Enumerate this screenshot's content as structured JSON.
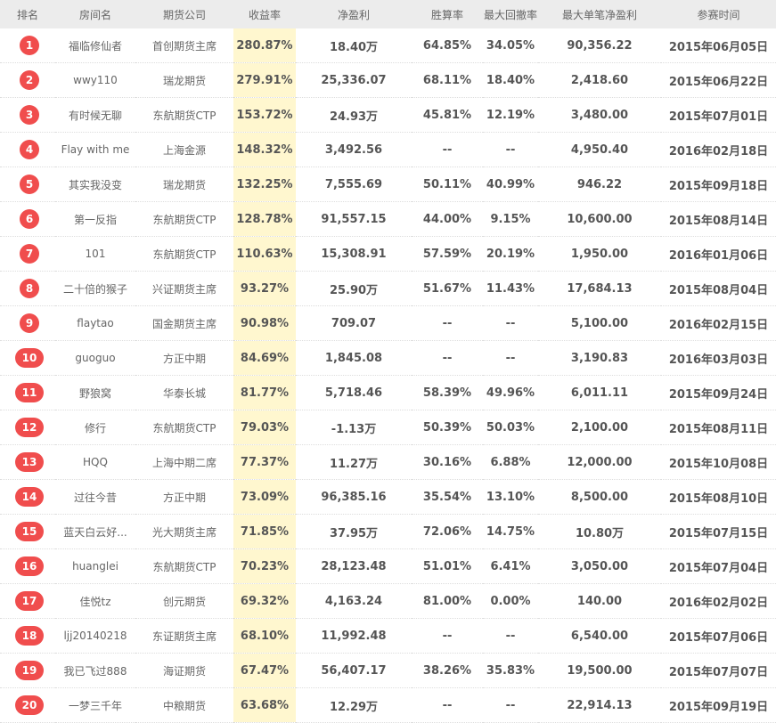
{
  "header": {
    "rank": "排名",
    "room": "房间名",
    "company": "期货公司",
    "return_rate": "收益率",
    "net_profit": "净盈利",
    "win_rate": "胜算率",
    "max_drawdown": "最大回撤率",
    "max_single": "最大单笔净盈利",
    "join_time": "参赛时间"
  },
  "rows": [
    {
      "rank": "1",
      "room": "福临修仙者",
      "company": "首创期货主席",
      "return_rate": "280.87%",
      "net_profit": "18.40万",
      "win_rate": "64.85%",
      "max_drawdown": "34.05%",
      "max_single": "90,356.22",
      "join_time": "2015年06月05日"
    },
    {
      "rank": "2",
      "room": "wwy110",
      "company": "瑞龙期货",
      "return_rate": "279.91%",
      "net_profit": "25,336.07",
      "win_rate": "68.11%",
      "max_drawdown": "18.40%",
      "max_single": "2,418.60",
      "join_time": "2015年06月22日"
    },
    {
      "rank": "3",
      "room": "有时候无聊",
      "company": "东航期货CTP",
      "return_rate": "153.72%",
      "net_profit": "24.93万",
      "win_rate": "45.81%",
      "max_drawdown": "12.19%",
      "max_single": "3,480.00",
      "join_time": "2015年07月01日"
    },
    {
      "rank": "4",
      "room": "Flay with me",
      "company": "上海金源",
      "return_rate": "148.32%",
      "net_profit": "3,492.56",
      "win_rate": "--",
      "max_drawdown": "--",
      "max_single": "4,950.40",
      "join_time": "2016年02月18日"
    },
    {
      "rank": "5",
      "room": "其实我没变",
      "company": "瑞龙期货",
      "return_rate": "132.25%",
      "net_profit": "7,555.69",
      "win_rate": "50.11%",
      "max_drawdown": "40.99%",
      "max_single": "946.22",
      "join_time": "2015年09月18日"
    },
    {
      "rank": "6",
      "room": "第一反指",
      "company": "东航期货CTP",
      "return_rate": "128.78%",
      "net_profit": "91,557.15",
      "win_rate": "44.00%",
      "max_drawdown": "9.15%",
      "max_single": "10,600.00",
      "join_time": "2015年08月14日"
    },
    {
      "rank": "7",
      "room": "101",
      "company": "东航期货CTP",
      "return_rate": "110.63%",
      "net_profit": "15,308.91",
      "win_rate": "57.59%",
      "max_drawdown": "20.19%",
      "max_single": "1,950.00",
      "join_time": "2016年01月06日"
    },
    {
      "rank": "8",
      "room": "二十倍的猴子",
      "company": "兴证期货主席",
      "return_rate": "93.27%",
      "net_profit": "25.90万",
      "win_rate": "51.67%",
      "max_drawdown": "11.43%",
      "max_single": "17,684.13",
      "join_time": "2015年08月04日"
    },
    {
      "rank": "9",
      "room": "flaytao",
      "company": "国金期货主席",
      "return_rate": "90.98%",
      "net_profit": "709.07",
      "win_rate": "--",
      "max_drawdown": "--",
      "max_single": "5,100.00",
      "join_time": "2016年02月15日"
    },
    {
      "rank": "10",
      "room": "guoguo",
      "company": "方正中期",
      "return_rate": "84.69%",
      "net_profit": "1,845.08",
      "win_rate": "--",
      "max_drawdown": "--",
      "max_single": "3,190.83",
      "join_time": "2016年03月03日"
    },
    {
      "rank": "11",
      "room": "野狼窝",
      "company": "华泰长城",
      "return_rate": "81.77%",
      "net_profit": "5,718.46",
      "win_rate": "58.39%",
      "max_drawdown": "49.96%",
      "max_single": "6,011.11",
      "join_time": "2015年09月24日"
    },
    {
      "rank": "12",
      "room": "修行",
      "company": "东航期货CTP",
      "return_rate": "79.03%",
      "net_profit": "-1.13万",
      "win_rate": "50.39%",
      "max_drawdown": "50.03%",
      "max_single": "2,100.00",
      "join_time": "2015年08月11日"
    },
    {
      "rank": "13",
      "room": "HQQ",
      "company": "上海中期二席",
      "return_rate": "77.37%",
      "net_profit": "11.27万",
      "win_rate": "30.16%",
      "max_drawdown": "6.88%",
      "max_single": "12,000.00",
      "join_time": "2015年10月08日"
    },
    {
      "rank": "14",
      "room": "过往今昔",
      "company": "方正中期",
      "return_rate": "73.09%",
      "net_profit": "96,385.16",
      "win_rate": "35.54%",
      "max_drawdown": "13.10%",
      "max_single": "8,500.00",
      "join_time": "2015年08月10日"
    },
    {
      "rank": "15",
      "room": "蓝天白云好...",
      "company": "光大期货主席",
      "return_rate": "71.85%",
      "net_profit": "37.95万",
      "win_rate": "72.06%",
      "max_drawdown": "14.75%",
      "max_single": "10.80万",
      "join_time": "2015年07月15日"
    },
    {
      "rank": "16",
      "room": "huanglei",
      "company": "东航期货CTP",
      "return_rate": "70.23%",
      "net_profit": "28,123.48",
      "win_rate": "51.01%",
      "max_drawdown": "6.41%",
      "max_single": "3,050.00",
      "join_time": "2015年07月04日"
    },
    {
      "rank": "17",
      "room": "佳悦tz",
      "company": "创元期货",
      "return_rate": "69.32%",
      "net_profit": "4,163.24",
      "win_rate": "81.00%",
      "max_drawdown": "0.00%",
      "max_single": "140.00",
      "join_time": "2016年02月02日"
    },
    {
      "rank": "18",
      "room": "ljj20140218",
      "company": "东证期货主席",
      "return_rate": "68.10%",
      "net_profit": "11,992.48",
      "win_rate": "--",
      "max_drawdown": "--",
      "max_single": "6,540.00",
      "join_time": "2015年07月06日"
    },
    {
      "rank": "19",
      "room": "我已飞过888",
      "company": "海证期货",
      "return_rate": "67.47%",
      "net_profit": "56,407.17",
      "win_rate": "38.26%",
      "max_drawdown": "35.83%",
      "max_single": "19,500.00",
      "join_time": "2015年07月07日"
    },
    {
      "rank": "20",
      "room": "一梦三千年",
      "company": "中粮期货",
      "return_rate": "63.68%",
      "net_profit": "12.29万",
      "win_rate": "--",
      "max_drawdown": "--",
      "max_single": "22,914.13",
      "join_time": "2015年09月19日"
    }
  ],
  "colors": {
    "header_bg": "#ececec",
    "rank_badge": "#f04d4d",
    "rate_column_bg": "#fff7cf"
  }
}
